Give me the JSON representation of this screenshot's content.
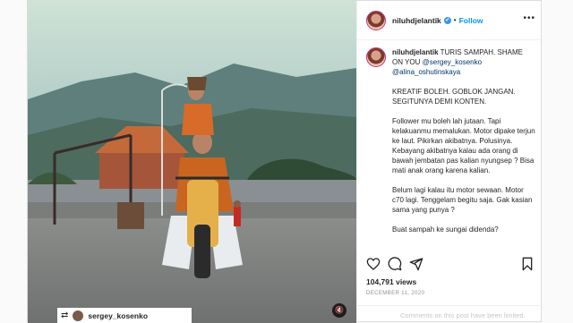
{
  "post": {
    "username": "niluhdjelantik",
    "verified_glyph": "✔",
    "separator": "•",
    "follow_label": "Follow",
    "more_glyph": "•••",
    "caption": {
      "username": "niluhdjelantik",
      "line1": "TURIS SAMPAH. SHAME ON YOU",
      "mention1": "@sergey_kosenko",
      "mention2": "@alina_oshutinskaya",
      "para2": "KREATIF BOLEH. GOBLOK JANGAN. SEGITUNYA DEMI KONTEN.",
      "para3": "Follower mu boleh lah jutaan. Tapi kelakuanmu memalukan. Motor dipake terjun ke laut. Pikirkan akibatnya. Polusinya. Kebayang akibatnya kalau ada orang di bawah jembatan pas kalian nyungsep ? Bisa mati anak orang karena kalian.",
      "para4": "Belum lagi kalau itu motor sewaan. Motor c70 lagi. Tenggelam begitu saja. Gak kasian sama yang punya ?",
      "para5": "Buat sampah ke sungai didenda?"
    },
    "likes": "104,791 views",
    "date": "DECEMBER 11, 2020",
    "comments_limited": "Comments on this post have been limited.",
    "icons": [
      "heart-icon",
      "comment-icon",
      "share-icon",
      "bookmark-icon"
    ]
  },
  "media": {
    "repost_icon": "⇄",
    "repost_user": "sergey_kosenko",
    "mute_glyph": "🔇"
  }
}
